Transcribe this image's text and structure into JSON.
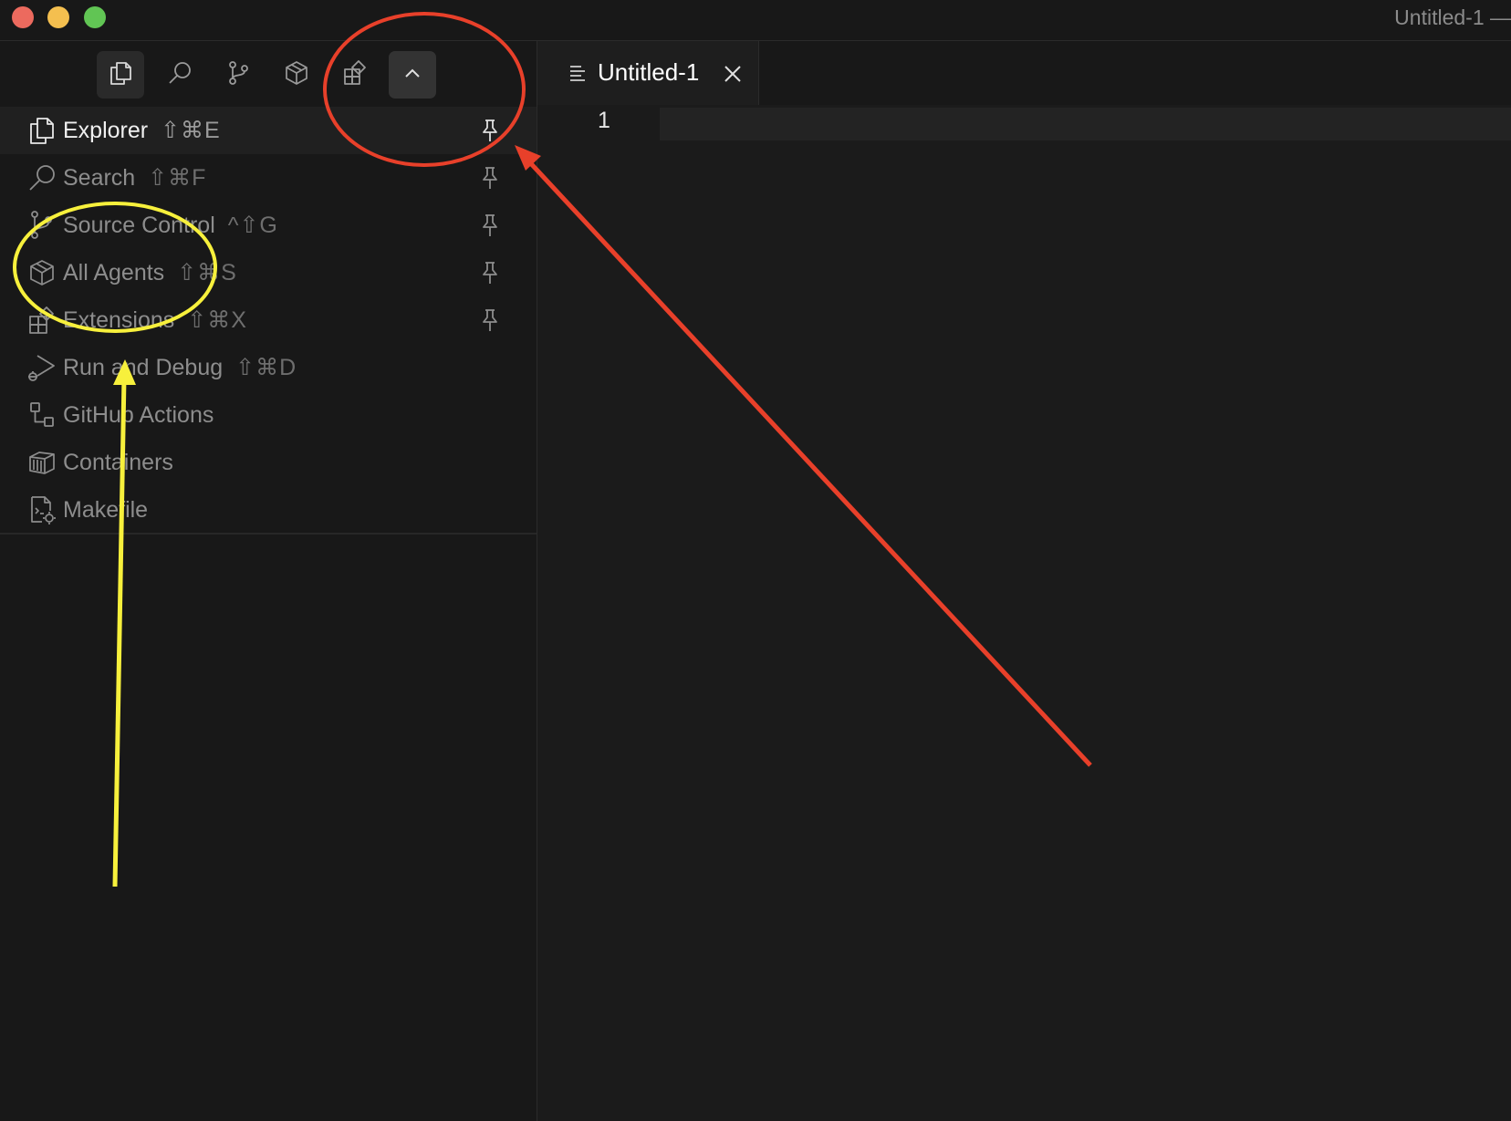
{
  "window": {
    "title": "Untitled-1 —"
  },
  "activity_bar": {
    "buttons": [
      {
        "icon": "explorer-icon",
        "active": true
      },
      {
        "icon": "search-icon"
      },
      {
        "icon": "source-control-icon"
      },
      {
        "icon": "agents-icon"
      },
      {
        "icon": "extensions-icon"
      },
      {
        "icon": "chevron-up-icon",
        "toggle": true
      }
    ]
  },
  "views": [
    {
      "label": "Explorer",
      "shortcut": "⇧⌘E",
      "icon": "explorer-icon",
      "pinned": true,
      "selected": true
    },
    {
      "label": "Search",
      "shortcut": "⇧⌘F",
      "icon": "search-icon",
      "pinned": true
    },
    {
      "label": "Source Control",
      "shortcut": "^⇧G",
      "icon": "source-control-icon",
      "pinned": true
    },
    {
      "label": "All Agents",
      "shortcut": "⇧⌘S",
      "icon": "agents-icon",
      "pinned": true
    },
    {
      "label": "Extensions",
      "shortcut": "⇧⌘X",
      "icon": "extensions-icon",
      "pinned": true
    },
    {
      "label": "Run and Debug",
      "shortcut": "⇧⌘D",
      "icon": "run-debug-icon"
    },
    {
      "label": "GitHub Actions",
      "shortcut": "",
      "icon": "github-actions-icon"
    },
    {
      "label": "Containers",
      "shortcut": "",
      "icon": "containers-icon"
    },
    {
      "label": "Makefile",
      "shortcut": "",
      "icon": "makefile-icon"
    }
  ],
  "editor": {
    "tab_label": "Untitled-1",
    "line_number": "1"
  },
  "annotation_colors": {
    "red": "#e8402a",
    "yellow": "#f7f03c"
  }
}
